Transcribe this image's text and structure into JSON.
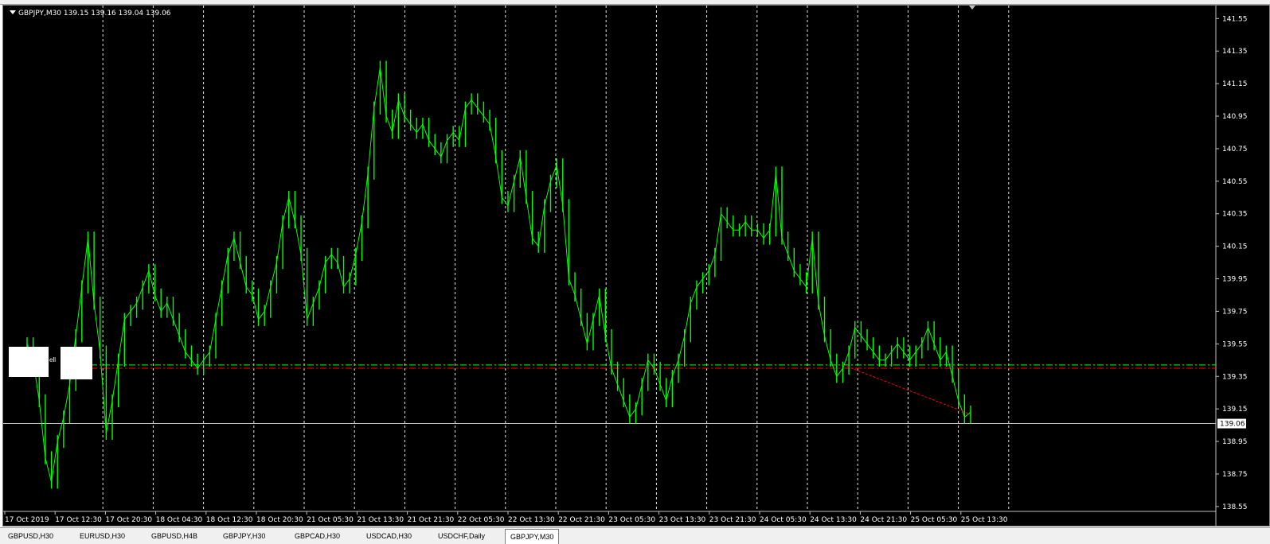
{
  "chart_header": {
    "symbol": "GBPJPY,M30",
    "open": "139.15",
    "high": "139.16",
    "low": "139.04",
    "close": "139.06"
  },
  "colors": {
    "background": "#000000",
    "candles": "#00ff00",
    "grid": "#ffffff",
    "axis_text": "#ffffff",
    "green_line": "#00ff00",
    "red_line": "#ff0000",
    "bid_line": "#c0c0c0"
  },
  "marker_label": "ell",
  "chart_data": {
    "type": "line",
    "title": "GBPJPY,M30",
    "y_ticks": [
      "141.55",
      "141.35",
      "141.15",
      "140.95",
      "140.75",
      "140.55",
      "140.35",
      "140.15",
      "139.95",
      "139.75",
      "139.55",
      "139.35",
      "139.15",
      "138.95",
      "138.75",
      "138.55"
    ],
    "ylim": [
      138.52,
      141.62
    ],
    "x_ticks": [
      "17 Oct 2019",
      "17 Oct 12:30",
      "17 Oct 20:30",
      "18 Oct 04:30",
      "18 Oct 12:30",
      "18 Oct 20:30",
      "21 Oct 05:30",
      "21 Oct 13:30",
      "21 Oct 21:30",
      "22 Oct 05:30",
      "22 Oct 13:30",
      "22 Oct 21:30",
      "23 Oct 05:30",
      "23 Oct 13:30",
      "23 Oct 21:30",
      "24 Oct 05:30",
      "24 Oct 13:30",
      "24 Oct 21:30",
      "25 Oct 05:30",
      "25 Oct 13:30"
    ],
    "current_price": "139.06",
    "green_level": 139.42,
    "red_level": 139.4,
    "trend_line": [
      139.42,
      139.12
    ],
    "grid": true,
    "series": [
      {
        "values": [
          139.55,
          139.45,
          139.2,
          138.85,
          138.7,
          138.95,
          139.1,
          139.3,
          139.6,
          139.9,
          140.2,
          139.8,
          139.5,
          139.0,
          139.2,
          139.45,
          139.7,
          139.75,
          139.8,
          139.9,
          140.0,
          139.85,
          139.75,
          139.8,
          139.7,
          139.6,
          139.5,
          139.45,
          139.4,
          139.45,
          139.5,
          139.7,
          139.9,
          140.1,
          140.2,
          140.05,
          139.9,
          139.85,
          139.7,
          139.75,
          139.9,
          140.05,
          140.3,
          140.45,
          140.3,
          140.1,
          139.7,
          139.8,
          139.9,
          140.05,
          140.1,
          140.05,
          139.9,
          139.95,
          140.1,
          140.3,
          140.6,
          141.0,
          141.25,
          140.95,
          140.85,
          141.05,
          140.95,
          140.9,
          140.85,
          140.9,
          140.8,
          140.75,
          140.7,
          140.8,
          140.85,
          140.8,
          141.0,
          141.05,
          141.0,
          140.95,
          140.9,
          140.7,
          140.45,
          140.4,
          140.55,
          140.7,
          140.45,
          140.2,
          140.15,
          140.4,
          140.55,
          140.65,
          140.4,
          139.95,
          139.85,
          139.7,
          139.55,
          139.7,
          139.85,
          139.6,
          139.4,
          139.3,
          139.2,
          139.1,
          139.15,
          139.3,
          139.45,
          139.4,
          139.3,
          139.2,
          139.35,
          139.45,
          139.6,
          139.8,
          139.9,
          139.95,
          140.0,
          140.1,
          140.35,
          140.3,
          140.25,
          140.25,
          140.3,
          140.25,
          140.25,
          140.2,
          140.25,
          140.6,
          140.2,
          140.1,
          140.0,
          139.95,
          139.9,
          140.2,
          139.8,
          139.6,
          139.45,
          139.35,
          139.4,
          139.5,
          139.65,
          139.6,
          139.55,
          139.5,
          139.45,
          139.45,
          139.5,
          139.55,
          139.5,
          139.45,
          139.5,
          139.55,
          139.65,
          139.55,
          139.45,
          139.5,
          139.35,
          139.2,
          139.1,
          139.13
        ]
      }
    ]
  },
  "tabs": [
    {
      "label": "GBPUSD,H30"
    },
    {
      "label": "EURUSD,H30"
    },
    {
      "label": "GBPUSD,H4B"
    },
    {
      "label": "GBPJPY,H30"
    },
    {
      "label": "GBPCAD,H30"
    },
    {
      "label": "USDCAD,H30"
    },
    {
      "label": "USDCHF,Daily"
    },
    {
      "label": "GBPJPY,M30"
    }
  ]
}
